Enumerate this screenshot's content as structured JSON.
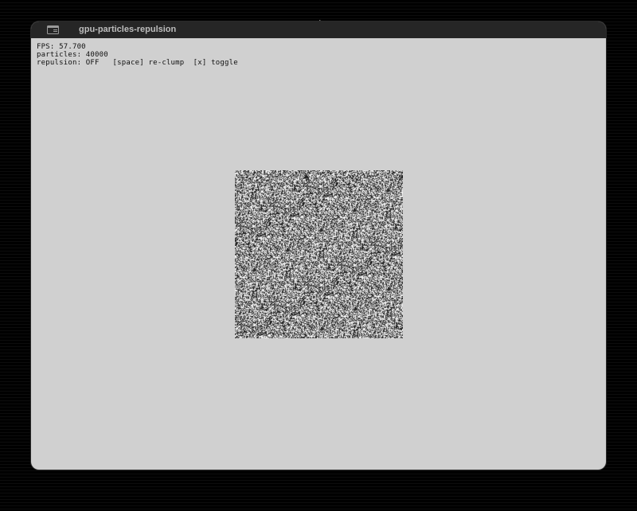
{
  "window": {
    "title": "gpu-particles-repulsion",
    "title_icon": "terminal-window-icon"
  },
  "hud": {
    "fps": "FPS: 57.700",
    "particles": "particles: 40000",
    "controls": "repulsion: OFF   [space] re-clump  [x] toggle"
  },
  "simulation": {
    "particle_count": 40000,
    "repulsion_on": false,
    "particle_color": "#f0f0f0",
    "background_color": "#d0d0d0",
    "clump_color": "#2a2a2a"
  }
}
